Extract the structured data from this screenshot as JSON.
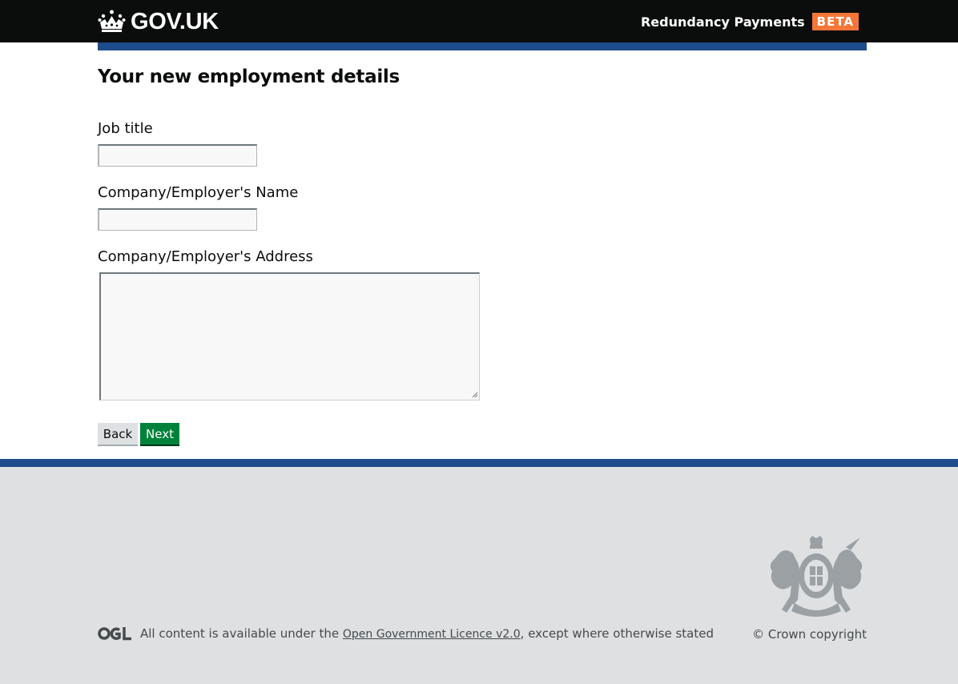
{
  "header": {
    "logo_text": "GOV.UK",
    "service_name": "Redundancy Payments",
    "phase_tag": "BETA"
  },
  "page": {
    "title": "Your new employment details"
  },
  "form": {
    "job_title": {
      "label": "Job title",
      "value": ""
    },
    "employer_name": {
      "label": "Company/Employer's Name",
      "value": ""
    },
    "employer_address": {
      "label": "Company/Employer's Address",
      "value": ""
    }
  },
  "buttons": {
    "back_label": "Back",
    "next_label": "Next"
  },
  "footer": {
    "licence_prefix": "All content is available under the ",
    "licence_link": "Open Government Licence v2.0",
    "licence_suffix": ", except where otherwise stated",
    "copyright": "© Crown copyright",
    "ogl_logo_text": "OGL"
  },
  "icons": {
    "logo": "crown-icon",
    "crest": "royal-coat-of-arms-icon",
    "ogl": "ogl-logo-icon"
  },
  "colors": {
    "header_bg": "#0b0c0c",
    "beta_tag": "#f47738",
    "brand_blue": "#1d4b8c",
    "next_button": "#00823b",
    "footer_bg": "#dee0e2"
  }
}
